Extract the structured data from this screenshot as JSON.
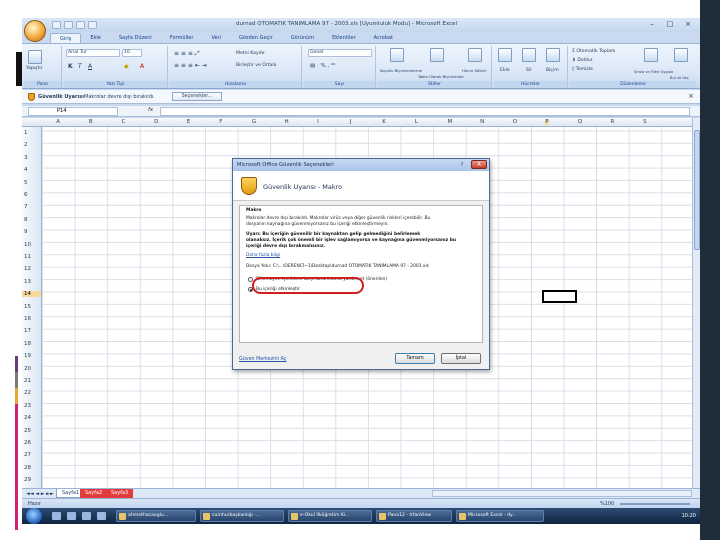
{
  "window": {
    "title": "durnad OTOMATIK TANIMLAMA 97 - 2003.xls [Uyumluluk Modu] - Microsoft Excel"
  },
  "ribbon": {
    "tabs": [
      "Giriş",
      "Ekle",
      "Sayfa Düzeni",
      "Formüller",
      "Veri",
      "Gözden Geçir",
      "Görünüm",
      "Eklentiler",
      "Acrobat"
    ],
    "font_name": "Arial Tur",
    "font_size": "10",
    "wrap_text": "Metni Kaydır",
    "merge_center": "Birleştir ve Ortala",
    "number_format": "Genel",
    "conditional_format": "Koşullu Biçimlendirme",
    "format_as_table": "Tablo Olarak Biçimlendir",
    "cell_styles": "Hücre Stilleri",
    "insert": "Ekle",
    "delete": "Sil",
    "format": "Biçim",
    "autosum": "Otomatik Toplam",
    "fill": "Doldur",
    "clear": "Temizle",
    "sort_filter": "Sırala ve Filtre Uygula",
    "find_select": "Bul ve Seç",
    "paste": "Yapıştır",
    "groups": {
      "clipboard": "Pano",
      "font": "Yazı Tipi",
      "alignment": "Hizalama",
      "number": "Sayı",
      "styles": "Stiller",
      "cells": "Hücreler",
      "editing": "Düzenleme"
    }
  },
  "security_bar": {
    "title": "Güvenlik Uyarısı",
    "message": "Makrolar devre dışı bırakıldı.",
    "options_button": "Seçenekler..."
  },
  "formula_bar": {
    "name_box": "P14",
    "fx": "fx"
  },
  "grid": {
    "columns": [
      "A",
      "B",
      "C",
      "D",
      "E",
      "F",
      "G",
      "H",
      "I",
      "J",
      "K",
      "L",
      "M",
      "N",
      "O",
      "P",
      "Q",
      "R",
      "S"
    ],
    "rows": [
      "1",
      "2",
      "3",
      "4",
      "5",
      "6",
      "7",
      "8",
      "9",
      "10",
      "11",
      "12",
      "13",
      "14",
      "15",
      "16",
      "17",
      "18",
      "19",
      "20",
      "21",
      "22",
      "23",
      "24",
      "25",
      "26",
      "27",
      "28",
      "29"
    ],
    "selected_column": "P",
    "selected_row": "14"
  },
  "sheet_tabs": {
    "active": "Sayfa1",
    "items": [
      "Sayfa1",
      "Sayfa2",
      "Sayfa3"
    ]
  },
  "status": {
    "ready": "Hazır",
    "zoom": "%100"
  },
  "dialog": {
    "title": "Microsoft Office Güvenlik Seçenekleri",
    "heading": "Güvenlik Uyarısı - Makro",
    "section": "Makro",
    "line1": "Makrolar devre dışı bırakıldı. Makrolar virüs veya diğer güvenlik riskleri içerebilir. Bu",
    "line2": "dosyanın kaynağına güvenmiyorsanız bu içeriği etkinleştirmeyin.",
    "warn1": "Uyarı: Bu içeriğin güvenilir bir kaynaktan gelip gelmediğini belirlemek",
    "warn2": "olanaksız. İçerik çok önemli bir işlev sağlamıyorsa ve kaynağına güvenmiyorsanız bu",
    "warn3": "içeriği devre dışı bırakmalısınız.",
    "more_info": "Daha fazla bilgi",
    "file_path": "Dosya Yolu:   C:\\...\\OERENCİ~1\\Desktop\\durnad OTOMATIK TANIMLAMA 97 - 2003.xls",
    "option_protect": "Bilinmeyen içeriklere karşı korunmama yardım et (önerilen)",
    "option_enable": "Bu içeriği etkinleştir",
    "trust_center_link": "Güven Merkezini Aç",
    "ok": "Tamam",
    "cancel": "İptal",
    "help_icon": "?",
    "close_icon": "X"
  },
  "taskbar": {
    "tasks": [
      "ahmethocaoglu...",
      "cumhurbaşkanlığı -...",
      "e-Okul İlköğretim Ki...",
      "Pano12 - IrfanView",
      "Microsoft Excel - dy..."
    ],
    "clock": "10:20"
  },
  "colors": {
    "ribbon_bg": "#d9e6f6",
    "highlight_oval": "#d11f1f",
    "selected_header": "#f9d99a",
    "taskbar": "#1a3356"
  }
}
